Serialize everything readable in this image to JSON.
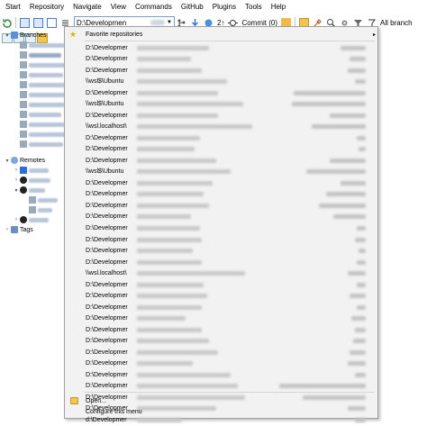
{
  "menu": [
    "Start",
    "Repository",
    "Navigate",
    "View",
    "Commands",
    "GitHub",
    "Plugins",
    "Tools",
    "Help"
  ],
  "toolbar": {
    "repo_combo": "D:\\Developmen",
    "pull_count": "2↑",
    "commit_label": "Commit (0)",
    "branch_filter": "All branch"
  },
  "tree": {
    "branches": "Branches",
    "remotes": "Remotes",
    "tags": "Tags",
    "remote_items": [
      "internal",
      "upstream",
      "origin"
    ],
    "origin_children": [
      "add_cus",
      "main"
    ],
    "last_remote": "zenodo"
  },
  "dropdown": {
    "favorites": "Favorite repositories",
    "items": [
      "D:\\Developmer",
      "D:\\Developmer",
      "D:\\Developmer",
      "\\\\wsl$\\Ubuntu",
      "D:\\Developmer",
      "\\\\wsl$\\Ubuntu",
      "D:\\Developmer",
      "\\\\wsl.localhost\\",
      "D:\\Developmer",
      "D:\\Developmer",
      "D:\\Developmer",
      "\\\\wsl$\\Ubuntu",
      "D:\\Developmer",
      "D:\\Developmer",
      "D:\\Developmer",
      "D:\\Developmer",
      "D:\\Developmer",
      "D:\\Developmer",
      "D:\\Developmer",
      "D:\\Developmer",
      "\\\\wsl.localhost\\",
      "D:\\Developmer",
      "D:\\Developmer",
      "D:\\Developmer",
      "D:\\Developmer",
      "D:\\Developmer",
      "D:\\Developmer",
      "D:\\Developmer",
      "D:\\Developmer",
      "D:\\Developmer",
      "D:\\Developmer",
      "D:\\Developmer",
      "D:\\Developmer",
      "d:\\Developmer",
      "D:\\Developmer"
    ],
    "open": "Open...",
    "configure": "Configure this menu"
  },
  "colors": {
    "accent": "#2b6fd6",
    "menu_bg": "#f2f2f2",
    "combo_border": "#7a9cd3"
  }
}
